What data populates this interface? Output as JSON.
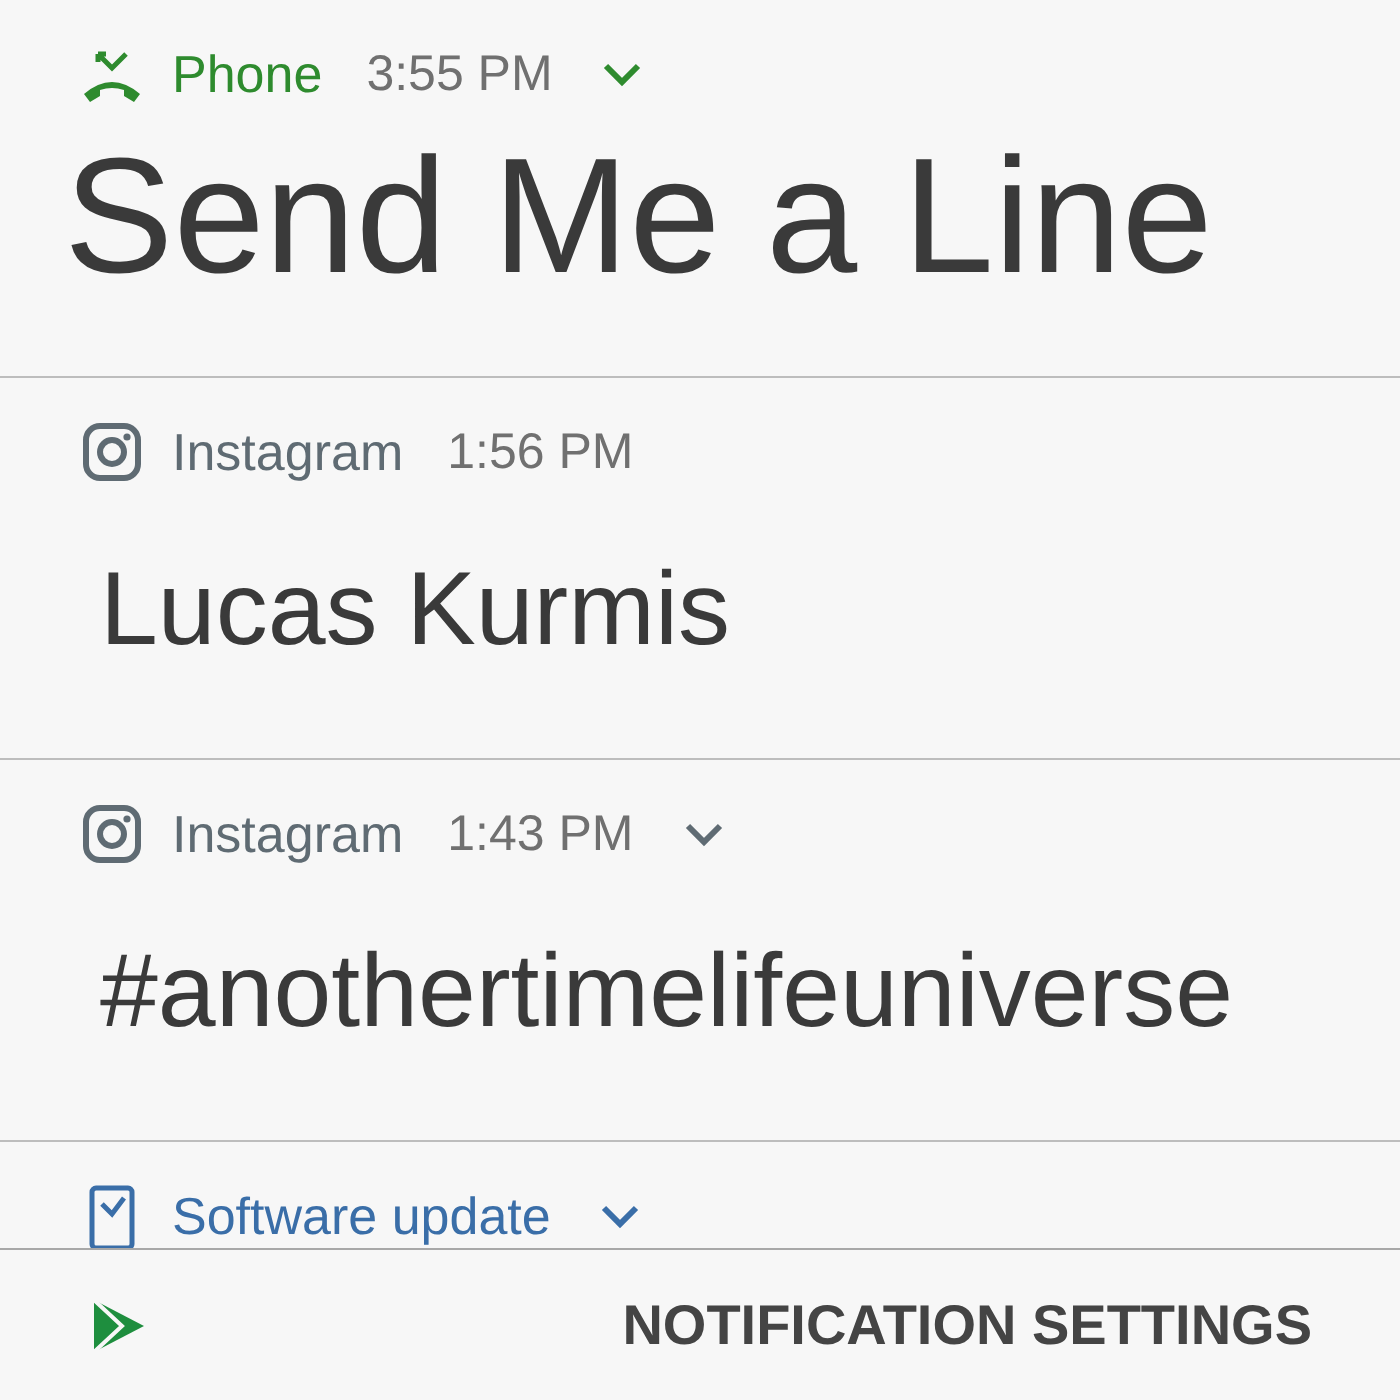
{
  "notifications": [
    {
      "kind": "phone",
      "app": "Phone",
      "color": "#2e8b2e",
      "time": "3:55 PM",
      "chevron": true,
      "title": "Send Me a Line"
    },
    {
      "kind": "instagram",
      "app": "Instagram",
      "color": "#5f6b73",
      "time": "1:56 PM",
      "chevron": false,
      "title": "Lucas Kurmis"
    },
    {
      "kind": "instagram",
      "app": "Instagram",
      "color": "#5f6b73",
      "time": "1:43 PM",
      "chevron": true,
      "title": "#anothertimelifeuniverse"
    },
    {
      "kind": "update",
      "app": "Software update",
      "color": "#3a6ea8",
      "chevron": true
    }
  ],
  "footer": {
    "action": "NOTIFICATION SETTINGS"
  }
}
